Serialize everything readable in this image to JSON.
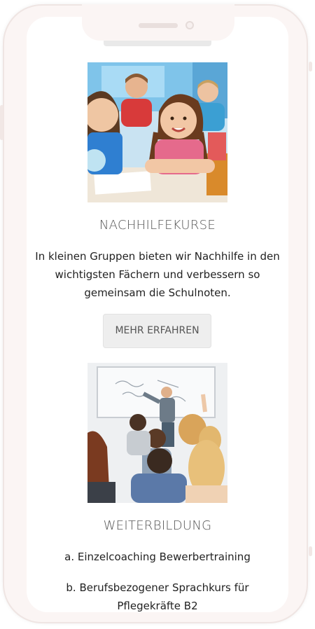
{
  "sections": [
    {
      "image_alt": "Kinder im Klassenzimmer",
      "title": "NACHHILFEKURSE",
      "text": "In kleinen Gruppen bieten wir Nachhilfe in den wichtigsten Fächern und verbessern so gemeinsam die Schulnoten.",
      "button_label": "MEHR ERFAHREN"
    },
    {
      "image_alt": "Lehrer vor einer Klasse",
      "title": "WEITERBILDUNG",
      "items": [
        "a. Einzelcoaching Bewerbertraining",
        "b. Berufsbezogener Sprachkurs für Pflegekräfte B2"
      ]
    }
  ],
  "colors": {
    "frame": "#fbf5f4",
    "button_bg": "#eeeeee",
    "heading": "#555555",
    "text": "#222222"
  }
}
